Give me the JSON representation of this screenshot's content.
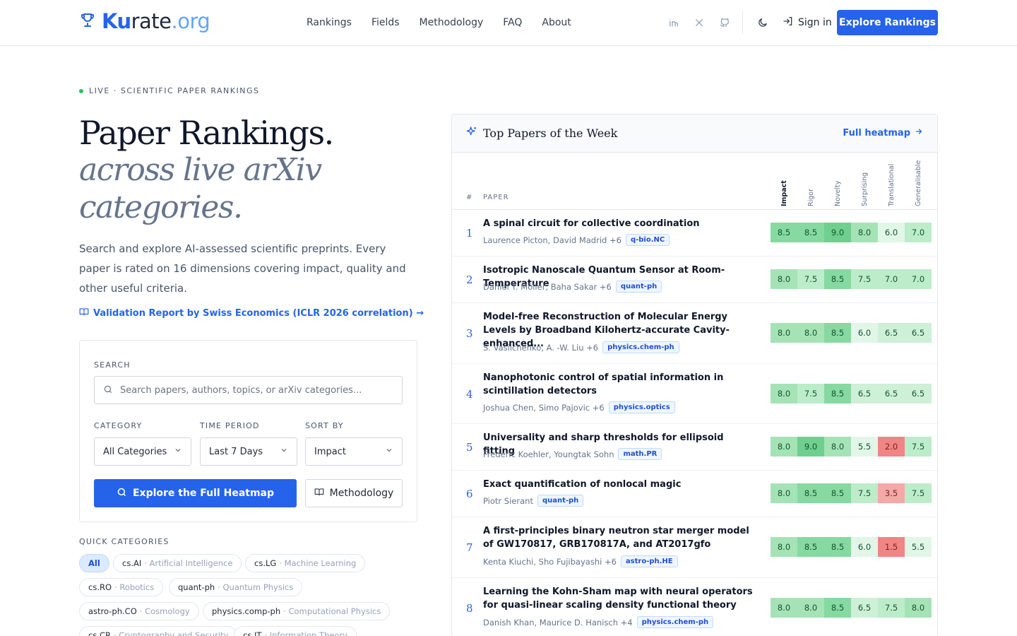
{
  "brand": {
    "part1": "Ku",
    "part2": "rate",
    "part3": ".org"
  },
  "nav": [
    "Rankings",
    "Fields",
    "Methodology",
    "FAQ",
    "About"
  ],
  "header": {
    "signin": "Sign in",
    "cta": "Explore Rankings"
  },
  "hero": {
    "eyebrow": "LIVE · SCIENTIFIC PAPER RANKINGS",
    "title": "Paper Rankings.",
    "subtitle": "across live arXiv categories.",
    "lead": "Search and explore AI-assessed scientific preprints. Every paper is rated on 16 dimensions covering impact, quality and other useful criteria.",
    "validation_link": "Validation Report by Swiss Economics (ICLR 2026 correlation) →"
  },
  "search": {
    "label": "SEARCH",
    "placeholder": "Search papers, authors, topics, or arXiv categories...",
    "category_label": "CATEGORY",
    "category_value": "All Categories",
    "period_label": "TIME PERIOD",
    "period_value": "Last 7 Days",
    "sort_label": "SORT BY",
    "sort_value": "Impact",
    "primary_btn": "Explore the Full Heatmap",
    "secondary_btn": "Methodology"
  },
  "quick": {
    "label": "QUICK CATEGORIES",
    "chips": [
      {
        "code": "All",
        "name": ""
      },
      {
        "code": "cs.AI",
        "name": "· Artificial Intelligence"
      },
      {
        "code": "cs.LG",
        "name": "· Machine Learning"
      },
      {
        "code": "cs.RO",
        "name": "· Robotics"
      },
      {
        "code": "quant-ph",
        "name": "· Quantum Physics"
      },
      {
        "code": "astro-ph.CO",
        "name": "· Cosmology"
      },
      {
        "code": "physics.comp-ph",
        "name": "· Computational Physics"
      },
      {
        "code": "cs.CR",
        "name": "· Cryptography and Security"
      },
      {
        "code": "cs.IT",
        "name": "· Information Theory"
      }
    ]
  },
  "card": {
    "title": "Top Papers of the Week",
    "link": "Full heatmap",
    "hash": "#",
    "paper_col": "PAPER",
    "columns": [
      "Impact",
      "Rigor",
      "Novelty",
      "Surprising",
      "Translational",
      "Generalisable"
    ],
    "rows": [
      {
        "rank": "1",
        "title": "A spinal circuit for collective coordination",
        "authors": "Laurence Picton, David Madrid +6",
        "tag": "q-bio.NC",
        "scores": [
          "8.5",
          "8.5",
          "9.0",
          "8.0",
          "6.0",
          "7.0"
        ]
      },
      {
        "rank": "2",
        "title": "Isotropic Nanoscale Quantum Sensor at Room-Temperature",
        "authors": "Daniel T. Möller, Baha Sakar +6",
        "tag": "quant-ph",
        "scores": [
          "8.0",
          "7.5",
          "8.5",
          "7.5",
          "7.0",
          "7.0"
        ]
      },
      {
        "rank": "3",
        "title": "Model-free Reconstruction of Molecular Energy Levels by Broadband Kilohertz-accurate Cavity-enhanced...",
        "authors": "S. Vasilchenko, A. -W. Liu +6",
        "tag": "physics.chem-ph",
        "scores": [
          "8.0",
          "8.0",
          "8.5",
          "6.0",
          "6.5",
          "6.5"
        ]
      },
      {
        "rank": "4",
        "title": "Nanophotonic control of spatial information in scintillation detectors",
        "authors": "Joshua Chen, Simo Pajovic +6",
        "tag": "physics.optics",
        "scores": [
          "8.0",
          "7.5",
          "8.5",
          "6.5",
          "6.5",
          "6.5"
        ]
      },
      {
        "rank": "5",
        "title": "Universality and sharp thresholds for ellipsoid fitting",
        "authors": "Frederic Koehler, Youngtak Sohn",
        "tag": "math.PR",
        "scores": [
          "8.0",
          "9.0",
          "8.0",
          "5.5",
          "2.0",
          "7.5"
        ]
      },
      {
        "rank": "6",
        "title": "Exact quantification of nonlocal magic",
        "authors": "Piotr Sierant",
        "tag": "quant-ph",
        "scores": [
          "8.0",
          "8.5",
          "8.5",
          "7.5",
          "3.5",
          "7.5"
        ]
      },
      {
        "rank": "7",
        "title": "A first-principles binary neutron star merger model of GW170817, GRB170817A, and AT2017gfo",
        "authors": "Kenta Kiuchi, Sho Fujibayashi +6",
        "tag": "astro-ph.HE",
        "scores": [
          "8.0",
          "8.5",
          "8.5",
          "6.0",
          "1.5",
          "5.5"
        ]
      },
      {
        "rank": "8",
        "title": "Learning the Kohn-Sham map with neural operators for quasi-linear scaling density functional theory",
        "authors": "Danish Khan, Maurice D. Hanisch +4",
        "tag": "physics.chem-ph",
        "scores": [
          "8.0",
          "8.0",
          "8.5",
          "6.5",
          "7.5",
          "8.0"
        ]
      }
    ]
  }
}
